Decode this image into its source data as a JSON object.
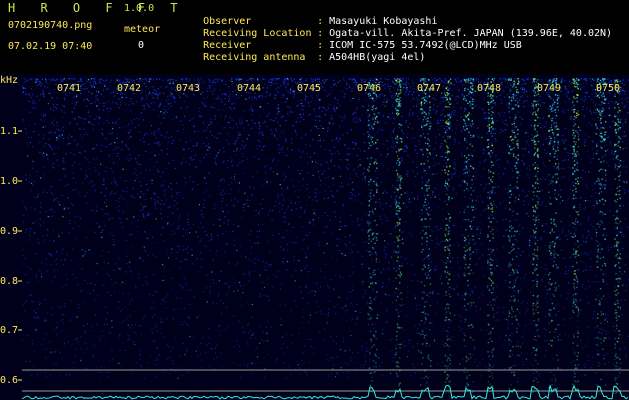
{
  "header": {
    "app_title": "H R O F F T",
    "app_version": "1.0.0",
    "file_name": "0702190740.png",
    "meteor_label": "meteor",
    "datetime": "07.02.19 07:40",
    "meteor_count": "0"
  },
  "station": [
    {
      "key": "Observer",
      "sep": ":",
      "value": "Masayuki Kobayashi"
    },
    {
      "key": "Receiving Location",
      "sep": ":",
      "value": "Ogata-vill. Akita-Pref. JAPAN (139.96E, 40.02N)"
    },
    {
      "key": "Receiver",
      "sep": ":",
      "value": "ICOM IC-575 53.7492(@LCD)MHz USB"
    },
    {
      "key": "Receiving antenna",
      "sep": ":",
      "value": "A504HB(yagi 4el)"
    }
  ],
  "spectrogram": {
    "freq_unit": "kHz",
    "freq_ticks": [
      "1.1",
      "1.0",
      "0.9",
      "0.8",
      "0.7",
      "0.6"
    ],
    "time_ticks": [
      "0741",
      "0742",
      "0743",
      "0744",
      "0745",
      "0746",
      "0747",
      "0748",
      "0749",
      "0750"
    ],
    "colors": {
      "background": "#00001a",
      "noise": "#1a3aff",
      "signal": "#2ef0e0",
      "peak": "#a8ff40",
      "label": "#ffe95a",
      "baseline": "#9a9a9a"
    }
  }
}
